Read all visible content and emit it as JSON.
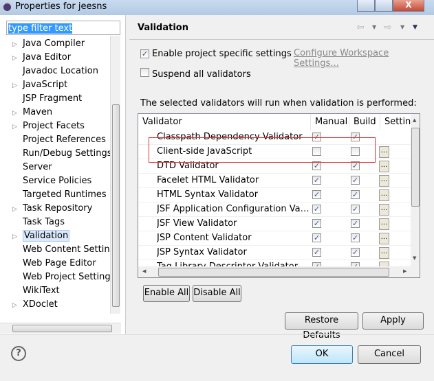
{
  "window": {
    "title": "Properties for jeesns",
    "minimize": "▁",
    "maximize": "□",
    "close": "X"
  },
  "sidebar": {
    "filter_value": "type filter text",
    "items": [
      {
        "label": "Java Compiler",
        "expandable": true
      },
      {
        "label": "Java Editor",
        "expandable": true
      },
      {
        "label": "Javadoc Location",
        "expandable": false
      },
      {
        "label": "JavaScript",
        "expandable": true
      },
      {
        "label": "JSP Fragment",
        "expandable": false
      },
      {
        "label": "Maven",
        "expandable": true
      },
      {
        "label": "Project Facets",
        "expandable": true
      },
      {
        "label": "Project References",
        "expandable": false
      },
      {
        "label": "Run/Debug Settings",
        "expandable": false
      },
      {
        "label": "Server",
        "expandable": false
      },
      {
        "label": "Service Policies",
        "expandable": false
      },
      {
        "label": "Targeted Runtimes",
        "expandable": false
      },
      {
        "label": "Task Repository",
        "expandable": true
      },
      {
        "label": "Task Tags",
        "expandable": false
      },
      {
        "label": "Validation",
        "expandable": true,
        "selected": true
      },
      {
        "label": "Web Content Settings",
        "expandable": false
      },
      {
        "label": "Web Page Editor",
        "expandable": false
      },
      {
        "label": "Web Project Settings",
        "expandable": false
      },
      {
        "label": "WikiText",
        "expandable": false
      },
      {
        "label": "XDoclet",
        "expandable": true
      }
    ]
  },
  "page": {
    "title": "Validation",
    "enable_specific": {
      "label": "Enable project specific settings",
      "checked": true
    },
    "configure_link": "Configure Workspace Settings...",
    "suspend": {
      "label": "Suspend all validators",
      "checked": false
    },
    "info": "The selected validators will run when validation is performed:",
    "columns": [
      "Validator",
      "Manual",
      "Build",
      "Settings"
    ],
    "rows": [
      {
        "name": "Classpath Dependency Validator",
        "manual": true,
        "build": true,
        "settings": false
      },
      {
        "name": "Client-side JavaScript",
        "manual": false,
        "build": false,
        "settings": true
      },
      {
        "name": "DTD Validator",
        "manual": true,
        "build": true,
        "settings": true
      },
      {
        "name": "Facelet HTML Validator",
        "manual": true,
        "build": true,
        "settings": true
      },
      {
        "name": "HTML Syntax Validator",
        "manual": true,
        "build": true,
        "settings": true
      },
      {
        "name": "JSF Application Configuration Validator",
        "manual": true,
        "build": true,
        "settings": true
      },
      {
        "name": "JSF View Validator",
        "manual": true,
        "build": true,
        "settings": true
      },
      {
        "name": "JSP Content Validator",
        "manual": true,
        "build": true,
        "settings": true
      },
      {
        "name": "JSP Syntax Validator",
        "manual": true,
        "build": true,
        "settings": true
      },
      {
        "name": "Tag Library Descriptor Validator",
        "manual": true,
        "build": true,
        "settings": true
      }
    ],
    "settings_btn": "...",
    "enable_all": "Enable All",
    "disable_all": "Disable All",
    "restore_defaults": "Restore Defaults",
    "apply": "Apply",
    "highlight_color": "#e03030"
  },
  "footer": {
    "help": "?",
    "ok": "OK",
    "cancel": "Cancel"
  }
}
